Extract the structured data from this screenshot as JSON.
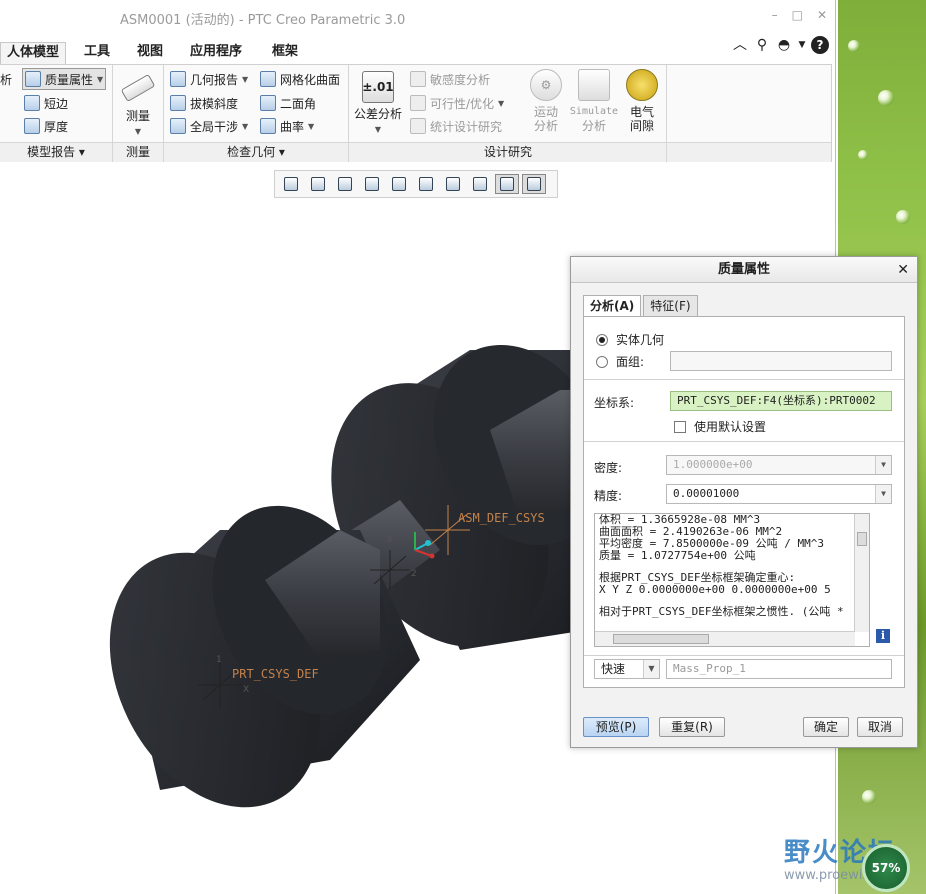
{
  "window": {
    "title": "ASM0001 (活动的) - PTC Creo Parametric 3.0",
    "controls": [
      "–",
      "□",
      "✕"
    ]
  },
  "menubar": {
    "tabs": [
      "人体模型",
      "工具",
      "视图",
      "应用程序",
      "框架"
    ]
  },
  "ribbon": {
    "model_report": {
      "clipped": "析",
      "mass_props": "质量属性",
      "short_edge": "短边",
      "thickness": "厚度",
      "footer": "模型报告 ▾"
    },
    "measure": {
      "label": "测量",
      "footer": "测量"
    },
    "inspect": {
      "geom_report": "几何报告",
      "mesh_surface": "网格化曲面",
      "draft": "拔模斜度",
      "dihedral": "二面角",
      "global_interference": "全局干涉",
      "curvature": "曲率",
      "footer": "检查几何 ▾"
    },
    "design_study": {
      "tolerance_icon": "±.01",
      "tolerance": "公差分析",
      "sensitivity": "敏感度分析",
      "feasibility": "可行性/优化",
      "statistical": "统计设计研究",
      "motion_1": "运动",
      "motion_2": "分析",
      "simulate_1": "Simulate",
      "simulate_2": "分析",
      "elec_1": "电气",
      "elec_2": "间隙",
      "footer": "设计研究"
    }
  },
  "model": {
    "csys_part": "PRT_CSYS_DEF",
    "csys_asm": "ASM_DEF_CSYS",
    "axis_x": "X",
    "axis_1": "1",
    "axis_2": "2",
    "axis_3": "3"
  },
  "dialog": {
    "title": "质量属性",
    "tab_analysis": "分析(A)",
    "tab_feature": "特征(F)",
    "solid_geometry": "实体几何",
    "quilt": "面组:",
    "csys_label": "坐标系:",
    "csys_value": "PRT_CSYS_DEF:F4(坐标系):PRT0002",
    "use_default": "使用默认设置",
    "density_label": "密度:",
    "density_value": "1.000000e+00",
    "accuracy_label": "精度:",
    "accuracy_value": "0.00001000",
    "results": [
      "体积 = 1.3665928e-08  MM^3",
      "曲面面积 = 2.4190263e-06  MM^2",
      "平均密度 = 7.8500000e-09 公吨 / MM^3",
      "质量 = 1.0727754e+00 公吨",
      "",
      "根据PRT_CSYS_DEF坐标框架确定重心:",
      "X   Y   Z  0.0000000e+00  0.0000000e+00  5",
      "",
      "相对于PRT_CSYS_DEF坐标框架之惯性. (公吨 *"
    ],
    "mode_value": "快速",
    "name_placeholder": "Mass_Prop_1",
    "info_icon": "i",
    "preview": "预览(P)",
    "repeat": "重复(R)",
    "ok": "确定",
    "cancel": "取消"
  },
  "watermark": {
    "brand": "野火论坛",
    "url": "www.proewildfire.",
    "badge": "57%"
  }
}
